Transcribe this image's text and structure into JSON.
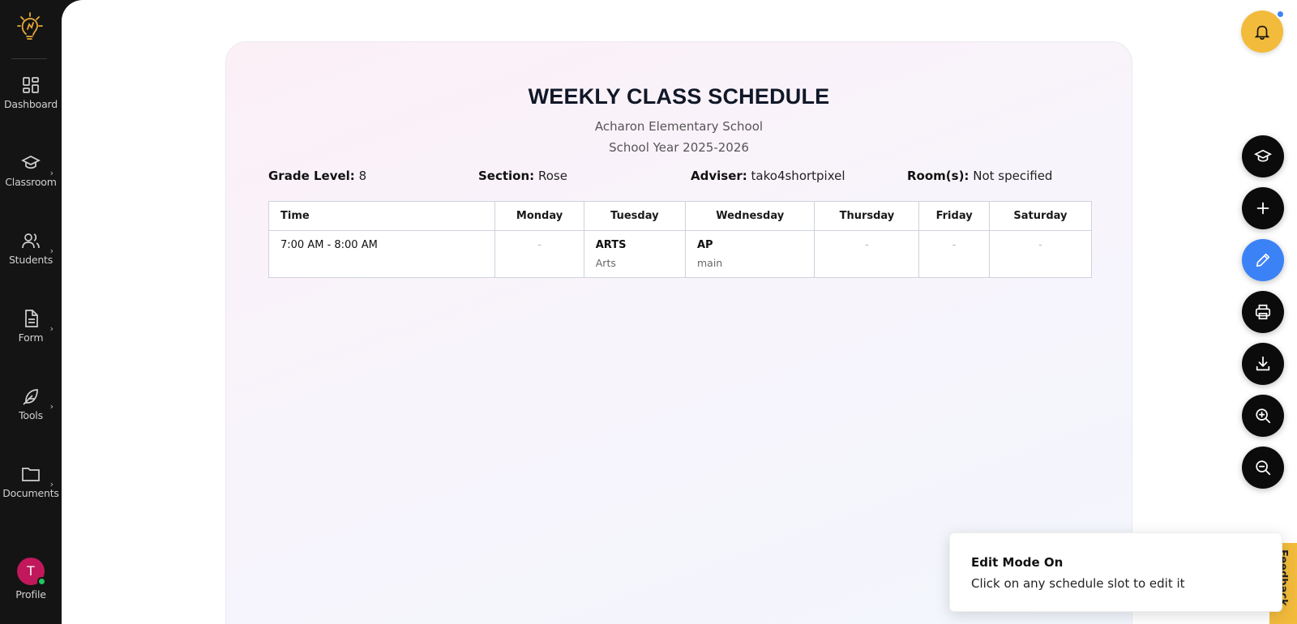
{
  "sidebar": {
    "items": [
      {
        "label": "Dashboard",
        "icon": "dashboard-grid-icon"
      },
      {
        "label": "Classroom",
        "icon": "graduation-cap-icon",
        "chevron": "›"
      },
      {
        "label": "Students",
        "icon": "users-icon",
        "chevron": "›"
      },
      {
        "label": "Form",
        "icon": "document-icon",
        "chevron": "›"
      },
      {
        "label": "Tools",
        "icon": "feather-icon",
        "chevron": "›"
      },
      {
        "label": "Documents",
        "icon": "folder-icon",
        "chevron": "›"
      }
    ],
    "profile": {
      "initial": "T",
      "label": "Profile"
    }
  },
  "schedule": {
    "title": "WEEKLY CLASS SCHEDULE",
    "school": "Acharon Elementary School",
    "school_year": "School Year 2025-2026",
    "grade_label": "Grade Level:",
    "grade_value": "8",
    "section_label": "Section:",
    "section_value": "Rose",
    "adviser_label": "Adviser:",
    "adviser_value": "tako4shortpixel",
    "rooms_label": "Room(s):",
    "rooms_value": "Not specified",
    "columns": [
      "Time",
      "Monday",
      "Tuesday",
      "Wednesday",
      "Thursday",
      "Friday",
      "Saturday"
    ],
    "rows": [
      {
        "time": "7:00 AM - 8:00 AM",
        "monday": "-",
        "tuesday": {
          "code": "ARTS",
          "name": "Arts"
        },
        "wednesday": {
          "code": "AP",
          "name": "main"
        },
        "thursday": "-",
        "friday": "-",
        "saturday": "-"
      }
    ]
  },
  "fabs": [
    "graduation-cap-icon",
    "plus-icon",
    "pencil-icon",
    "printer-icon",
    "download-icon",
    "zoom-in-icon",
    "zoom-out-icon"
  ],
  "toast": {
    "title": "Edit Mode On",
    "message": "Click on any schedule slot to edit it"
  },
  "feedback_label": "Feedback",
  "colors": {
    "accent_yellow": "#f2bb3c",
    "edit_blue": "#3b82f6",
    "sidebar_bg": "#141414",
    "avatar": "#c0185b"
  }
}
